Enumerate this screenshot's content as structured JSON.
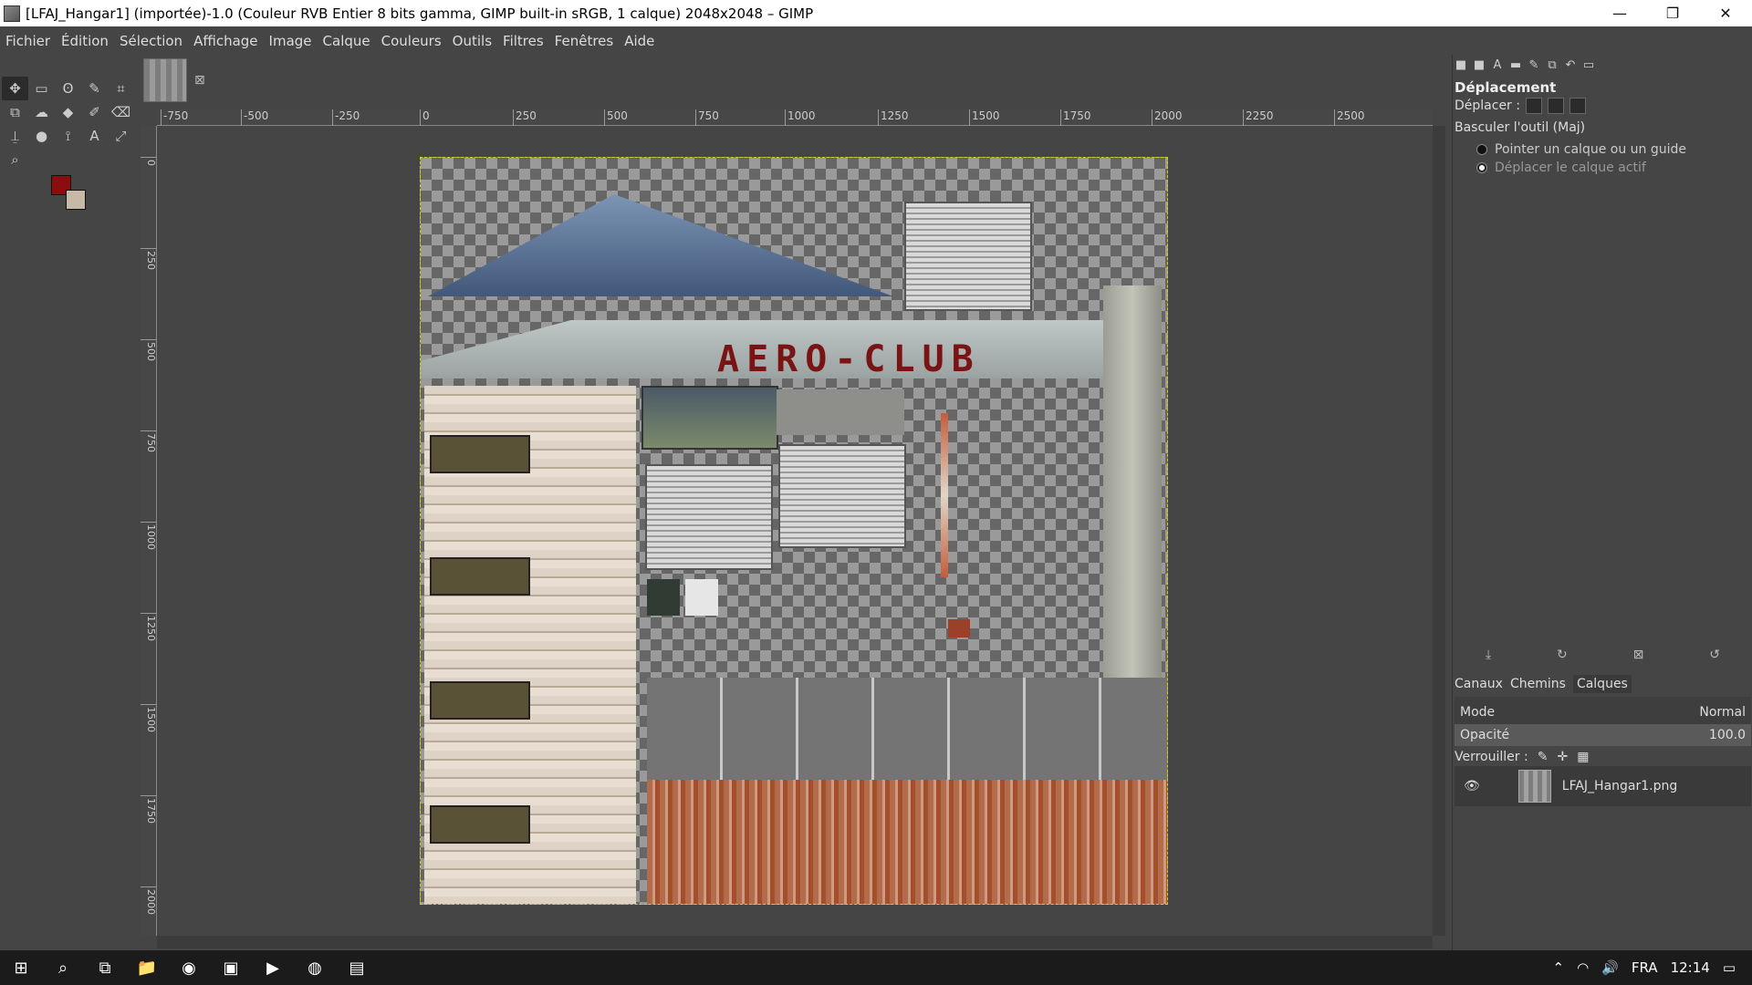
{
  "window": {
    "title": "[LFAJ_Hangar1] (importée)-1.0 (Couleur RVB Entier 8 bits gamma, GIMP built-in sRGB, 1 calque) 2048x2048 – GIMP",
    "minimize": "—",
    "maximize": "❐",
    "close": "✕"
  },
  "menu": [
    "Fichier",
    "Édition",
    "Sélection",
    "Affichage",
    "Image",
    "Calque",
    "Couleurs",
    "Outils",
    "Filtres",
    "Fenêtres",
    "Aide"
  ],
  "toolbox": {
    "tools": [
      "move-tool",
      "rect-select-tool",
      "free-select-tool",
      "fuzzy-select-tool",
      "crop-tool",
      "transform-tool",
      "warp-tool",
      "bucket-fill-tool",
      "paintbrush-tool",
      "eraser-tool",
      "clone-tool",
      "smudge-tool",
      "path-tool",
      "text-tool",
      "color-picker-tool",
      "zoom-tool"
    ],
    "tool_glyphs": [
      "✥",
      "▭",
      "ʘ",
      "✎",
      "⌗",
      "⧉",
      "☁",
      "◆",
      "✐",
      "⌫",
      "⍊",
      "●",
      "⟟",
      "A",
      "⤢",
      "⌕"
    ],
    "fg_color": "#8b0d0d",
    "bg_color": "#c6b9a5"
  },
  "image_tab": {
    "close_label": "⊠"
  },
  "rulers": {
    "h": [
      "-750",
      "-500",
      "-250",
      "0",
      "250",
      "500",
      "750",
      "1000",
      "1250",
      "1500",
      "1750",
      "2000",
      "2250",
      "2500"
    ],
    "v": [
      "0",
      "250",
      "500",
      "750",
      "1000",
      "1250",
      "1500",
      "1750",
      "2000"
    ]
  },
  "canvas": {
    "sign_text": "AERO-CLUB"
  },
  "tool_options": {
    "title": "Déplacement",
    "move_label": "Déplacer :",
    "toggle_label": "Basculer l'outil (Maj)",
    "radio1": "Pointer un calque ou un guide",
    "radio2": "Déplacer le calque actif"
  },
  "layers": {
    "tabs": [
      "Canaux",
      "Chemins",
      "Calques"
    ],
    "mode_label": "Mode",
    "mode_value": "Normal",
    "opacity_label": "Opacité",
    "opacity_value": "100.0",
    "lock_label": "Verrouiller :",
    "layer_name": "LFAJ_Hangar1.png"
  },
  "taskbar": {
    "lang": "FRA",
    "time": "12:14"
  }
}
